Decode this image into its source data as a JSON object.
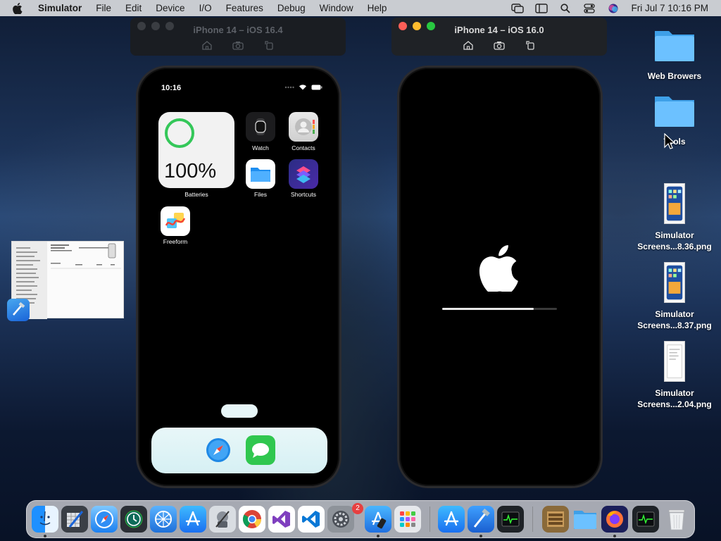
{
  "menubar": {
    "app_name": "Simulator",
    "items": [
      "File",
      "Edit",
      "Device",
      "I/O",
      "Features",
      "Debug",
      "Window",
      "Help"
    ],
    "clock": "Fri Jul 7  10:16 PM"
  },
  "sim_windows": [
    {
      "title": "iPhone 14 – iOS 16.4"
    },
    {
      "title": "iPhone 14 – iOS 16.0"
    }
  ],
  "phone1": {
    "status_time": "10:16",
    "battery_widget": {
      "percent": "100%",
      "label": "Batteries"
    },
    "apps": [
      {
        "label": "Watch"
      },
      {
        "label": "Contacts"
      },
      {
        "label": "Files"
      },
      {
        "label": "Shortcuts"
      },
      {
        "label": "Freeform"
      }
    ],
    "dock_apps": [
      "Safari",
      "Messages"
    ]
  },
  "phone2": {
    "boot_progress": 0.8
  },
  "desktop": [
    {
      "label": "Web Browers"
    },
    {
      "label": "Tools"
    },
    {
      "label": "Simulator Screens...8.36.png"
    },
    {
      "label": "Simulator Screens...8.37.png"
    },
    {
      "label": "Simulator Screens...2.04.png"
    }
  ],
  "dock": {
    "badge": "2",
    "apps": [
      "Finder",
      "Xcode Instruments",
      "Safari",
      "Time Machine",
      "Network",
      "App Store",
      "Automator",
      "Chrome",
      "Visual Studio",
      "VS Code",
      "System Preferences",
      "Simulator",
      "Launchpad",
      "App Store",
      "Xcode",
      "Activity Monitor",
      "Archive",
      "Folder",
      "Firefox",
      "Activity Monitor",
      "Trash"
    ]
  },
  "colors": {
    "accent": "#1a7ff0",
    "wallpaper": "#1c3358"
  }
}
